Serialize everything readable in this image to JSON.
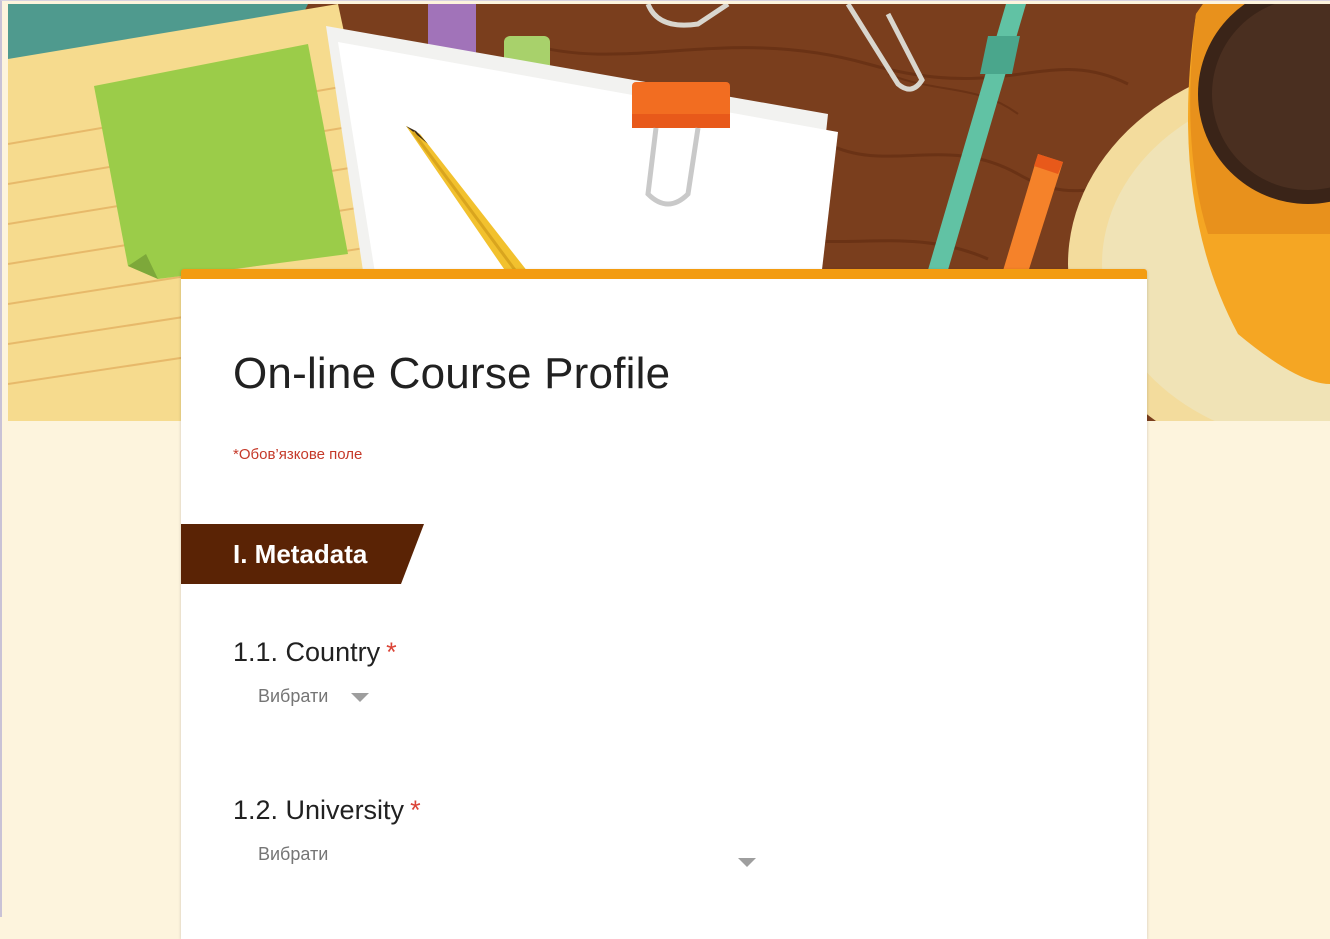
{
  "form": {
    "title": "On-line Course Profile",
    "required_note": "*Обов’язкове поле",
    "accent_color": "#f39c12",
    "background_color": "#fdf4dd"
  },
  "section": {
    "title": "I. Metadata",
    "color": "#5a2305"
  },
  "questions": [
    {
      "label": "1.1. Country",
      "required_mark": "*",
      "placeholder": "Вибрати"
    },
    {
      "label": "1.2. University",
      "required_mark": "*",
      "placeholder": "Вибрати"
    }
  ],
  "icons": {
    "dropdown": "chevron-down-icon"
  }
}
